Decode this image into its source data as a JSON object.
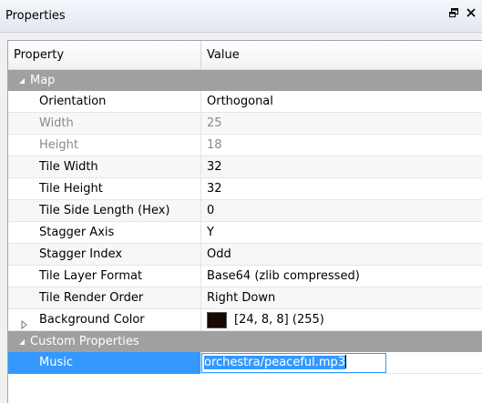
{
  "panel": {
    "title": "Properties",
    "float_icon": "float-window-icon",
    "close_icon": "close-icon"
  },
  "table": {
    "header": {
      "property": "Property",
      "value": "Value"
    },
    "groups": [
      {
        "label": "Map",
        "rows": [
          {
            "name": "Orientation",
            "value": "Orthogonal",
            "enabled": true
          },
          {
            "name": "Width",
            "value": "25",
            "enabled": false
          },
          {
            "name": "Height",
            "value": "18",
            "enabled": false
          },
          {
            "name": "Tile Width",
            "value": "32",
            "enabled": true
          },
          {
            "name": "Tile Height",
            "value": "32",
            "enabled": true
          },
          {
            "name": "Tile Side Length (Hex)",
            "value": "0",
            "enabled": true
          },
          {
            "name": "Stagger Axis",
            "value": "Y",
            "enabled": true
          },
          {
            "name": "Stagger Index",
            "value": "Odd",
            "enabled": true
          },
          {
            "name": "Tile Layer Format",
            "value": "Base64 (zlib compressed)",
            "enabled": true
          },
          {
            "name": "Tile Render Order",
            "value": "Right Down",
            "enabled": true
          },
          {
            "name": "Background Color",
            "value": "[24, 8, 8] (255)",
            "swatch_color": "#180808",
            "expandable": true,
            "enabled": true
          }
        ]
      },
      {
        "label": "Custom Properties",
        "rows": [
          {
            "name": "Music",
            "value": "orchestra/peaceful.mp3",
            "editing": true,
            "selected": true
          }
        ]
      }
    ]
  },
  "colors": {
    "selection": "#3399ff",
    "group_header": "#a0a0a0",
    "disabled_text": "#8a8a8a"
  }
}
